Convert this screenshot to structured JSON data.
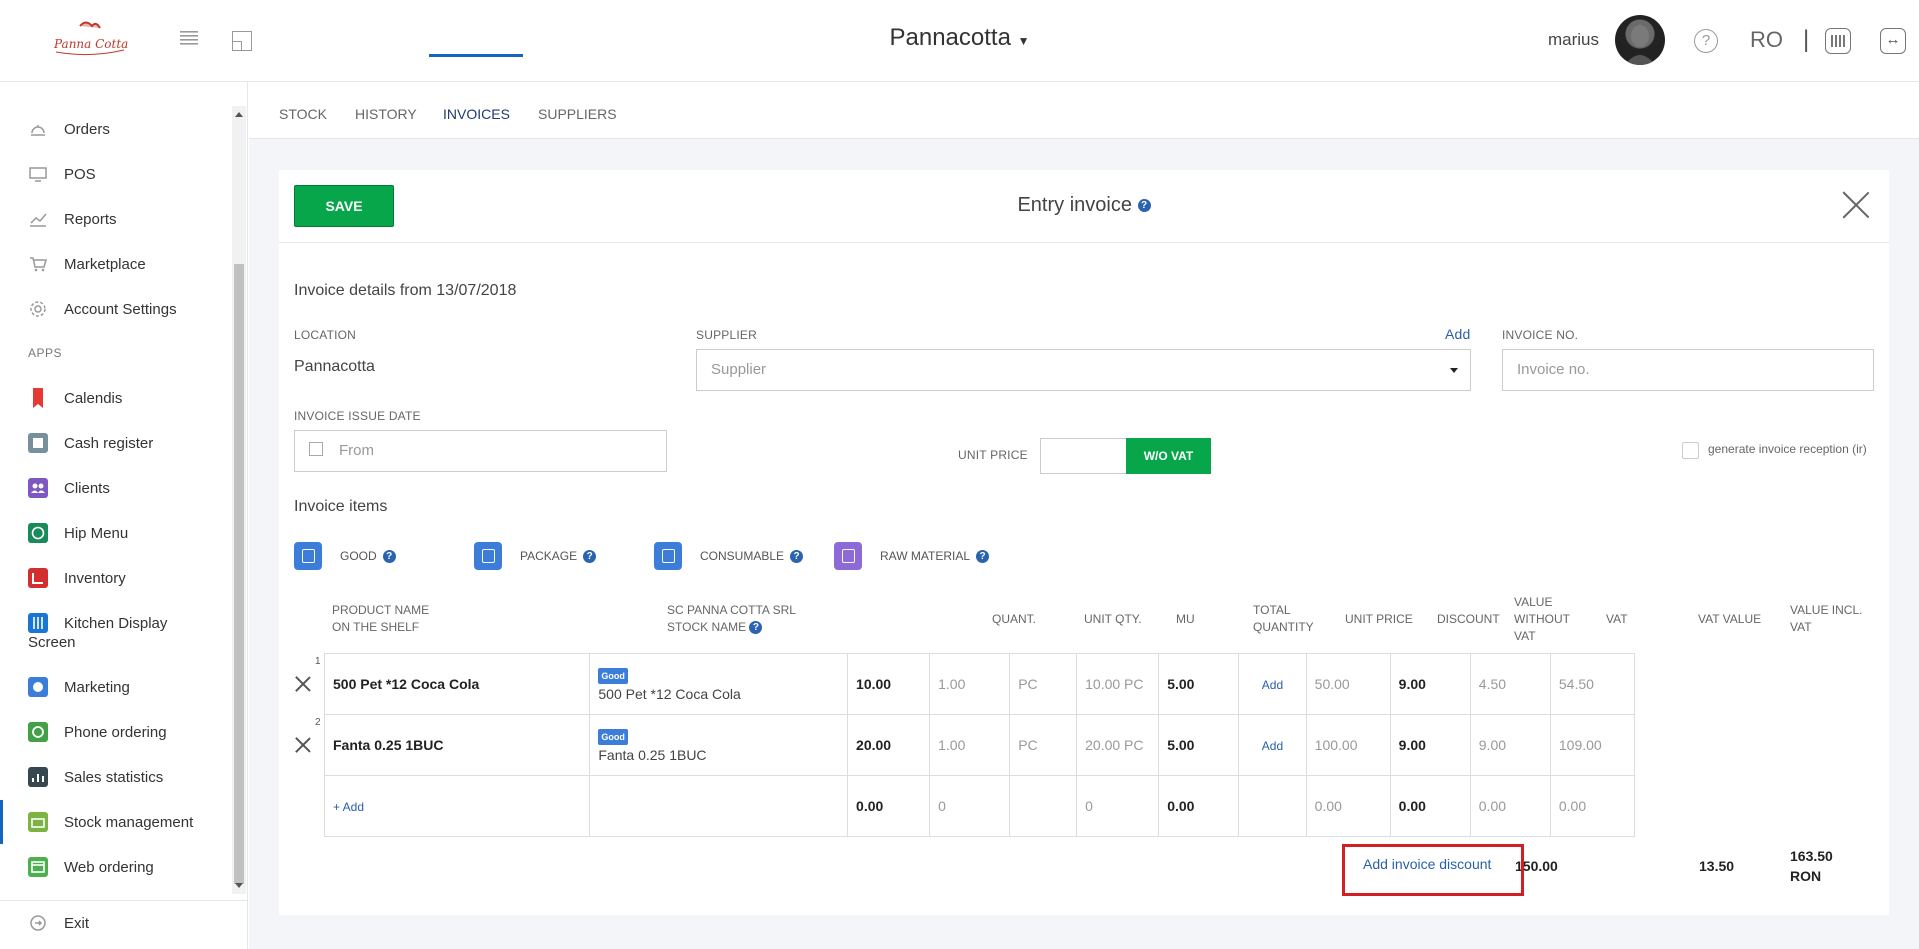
{
  "header": {
    "brand": "Pannacotta",
    "user_name": "marius",
    "language": "RO",
    "separator": "|"
  },
  "sidebar": {
    "items": [
      {
        "label": "Orders",
        "icon": "orders-icon"
      },
      {
        "label": "POS",
        "icon": "pos-icon"
      },
      {
        "label": "Reports",
        "icon": "reports-icon"
      },
      {
        "label": "Marketplace",
        "icon": "marketplace-icon"
      },
      {
        "label": "Account Settings",
        "icon": "settings-icon"
      }
    ],
    "apps_label": "APPS",
    "apps": [
      {
        "label": "Calendis",
        "color": "#e53935"
      },
      {
        "label": "Cash register",
        "color": "#78909c"
      },
      {
        "label": "Clients",
        "color": "#7e57c2"
      },
      {
        "label": "Hip Menu",
        "color": "#1b8a5a"
      },
      {
        "label": "Inventory",
        "color": "#d32f2f"
      },
      {
        "label": "Kitchen Display",
        "label2": "Screen",
        "color": "#1976d2"
      },
      {
        "label": "Marketing",
        "color": "#3b7dd8"
      },
      {
        "label": "Phone ordering",
        "color": "#43a047"
      },
      {
        "label": "Sales statistics",
        "color": "#37474f"
      },
      {
        "label": "Stock management",
        "color": "#7cb342"
      },
      {
        "label": "Web ordering",
        "color": "#4caf50"
      }
    ],
    "exit_label": "Exit"
  },
  "tabs": [
    "STOCK",
    "HISTORY",
    "INVOICES",
    "SUPPLIERS"
  ],
  "active_tab": "INVOICES",
  "card": {
    "save_label": "SAVE",
    "title": "Entry invoice",
    "help_mark": "?",
    "details_title": "Invoice details from 13/07/2018",
    "location_label": "LOCATION",
    "location_value": "Pannacotta",
    "supplier_label": "SUPPLIER",
    "supplier_add": "Add",
    "supplier_placeholder": "Supplier",
    "invoice_no_label": "INVOICE NO.",
    "invoice_no_placeholder": "Invoice no.",
    "issue_date_label": "INVOICE ISSUE DATE",
    "issue_date_placeholder": "From",
    "unit_price_label": "UNIT PRICE",
    "unit_price_toggle": "W/O VAT",
    "generate_label": "generate invoice reception (ir)",
    "items_title": "Invoice items",
    "item_types": [
      "GOOD",
      "PACKAGE",
      "CONSUMABLE",
      "RAW MATERIAL"
    ]
  },
  "table": {
    "headers": {
      "product": [
        "PRODUCT NAME",
        "ON THE SHELF"
      ],
      "stock": [
        "SC PANNA COTTA SRL",
        "STOCK NAME"
      ],
      "quant": "QUANT.",
      "unit_qty": "UNIT QTY.",
      "mu": "MU",
      "total_qty": [
        "TOTAL",
        "QUANTITY"
      ],
      "unit_price": "UNIT PRICE",
      "discount": "DISCOUNT",
      "value_wo_vat": [
        "VALUE",
        "WITHOUT",
        "VAT"
      ],
      "vat": "VAT",
      "vat_value": "VAT VALUE",
      "value_incl_vat": [
        "VALUE INCL.",
        "VAT"
      ]
    },
    "rows": [
      {
        "num": "1",
        "product": "500 Pet *12 Coca Cola",
        "badge": "Good",
        "stock_name": "500 Pet *12 Coca Cola",
        "quant": "10.00",
        "unit_qty": "1.00",
        "mu": "PC",
        "total_qty": "10.00 PC",
        "unit_price": "5.00",
        "discount": "Add",
        "value_wo_vat": "50.00",
        "vat": "9.00",
        "vat_value": "4.50",
        "value_incl_vat": "54.50"
      },
      {
        "num": "2",
        "product": "Fanta 0.25 1BUC",
        "badge": "Good",
        "stock_name": "Fanta 0.25 1BUC",
        "quant": "20.00",
        "unit_qty": "1.00",
        "mu": "PC",
        "total_qty": "20.00 PC",
        "unit_price": "5.00",
        "discount": "Add",
        "value_wo_vat": "100.00",
        "vat": "9.00",
        "vat_value": "9.00",
        "value_incl_vat": "109.00"
      }
    ],
    "add_row": {
      "label": "+ Add",
      "quant": "0.00",
      "unit_qty": "0",
      "total_qty": "0",
      "unit_price": "0.00",
      "value_wo_vat": "0.00",
      "vat": "0.00",
      "vat_value": "0.00",
      "value_incl_vat": "0.00"
    },
    "totals": {
      "add_discount": "Add invoice discount",
      "value_wo_vat": "150.00",
      "vat_value": "13.50",
      "value_incl_vat": "163.50",
      "currency": "RON"
    }
  }
}
